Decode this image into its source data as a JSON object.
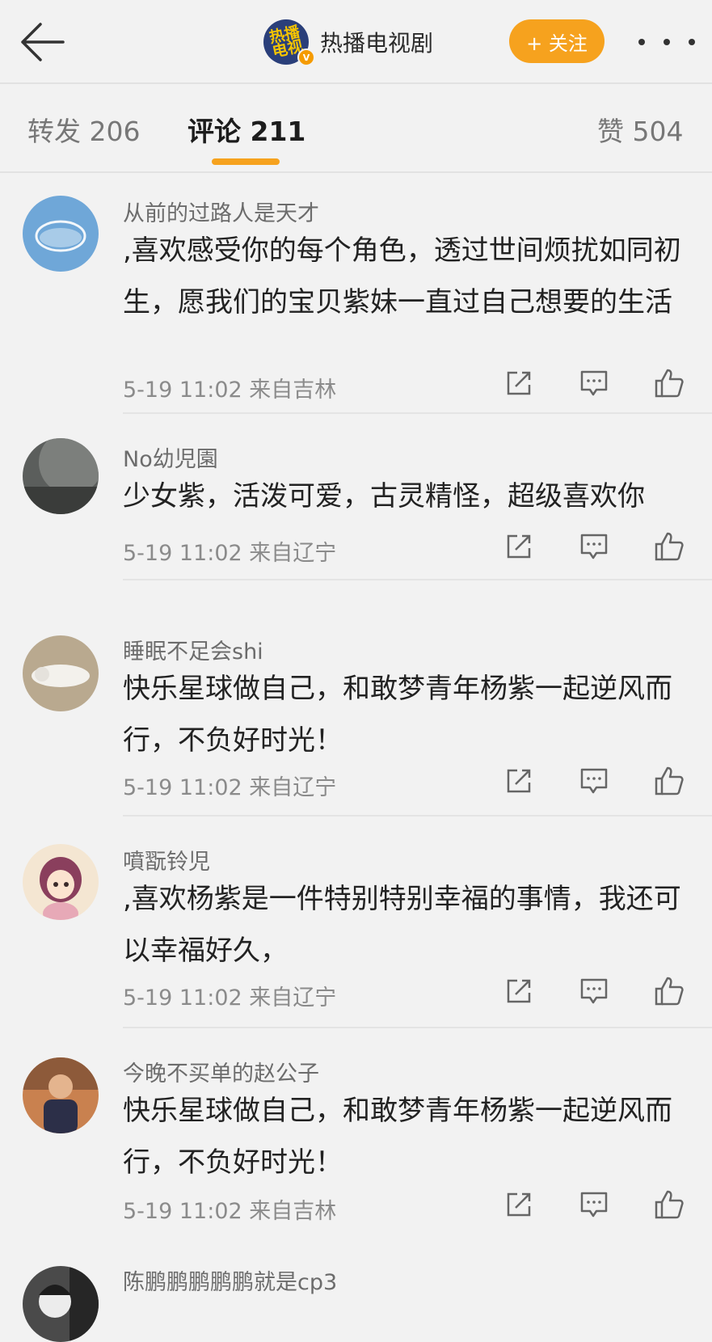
{
  "header": {
    "account_name": "热播电视剧",
    "account_logo_text": "热播电视剧",
    "verified_badge": "V",
    "follow_label": "+ 关注"
  },
  "tabs": {
    "repost": "转发 206",
    "comments": "评论 211",
    "likes": "赞 504"
  },
  "colors": {
    "accent": "#f6a21e",
    "background": "#f2f2f2"
  },
  "comments": [
    {
      "user": "从前的过路人是天才",
      "text": ",喜欢感受你的每个角色，透过世间烦扰如同初生，愿我们的宝贝紫妹一直过自己想要的生活",
      "meta": "5-19 11:02  来自吉林"
    },
    {
      "user": "No幼児園",
      "text": "少女紫，活泼可爱，古灵精怪，超级喜欢你",
      "meta": "5-19 11:02  来自辽宁"
    },
    {
      "user": "睡眠不足会shi",
      "text": "快乐星球做自己，和敢梦青年杨紫一起逆风而行，不负好时光！",
      "meta": "5-19 11:02  来自辽宁"
    },
    {
      "user": "噴翫铃児",
      "text": ",喜欢杨紫是一件特别特别幸福的事情，我还可以幸福好久，",
      "meta": "5-19 11:02  来自辽宁"
    },
    {
      "user": "今晚不买单的赵公子",
      "text": "快乐星球做自己，和敢梦青年杨紫一起逆风而行，不负好时光！",
      "meta": "5-19 11:02  来自吉林"
    },
    {
      "user": "陈鹏鹏鹏鹏鹏就是cp3",
      "text": "",
      "meta": ""
    }
  ]
}
